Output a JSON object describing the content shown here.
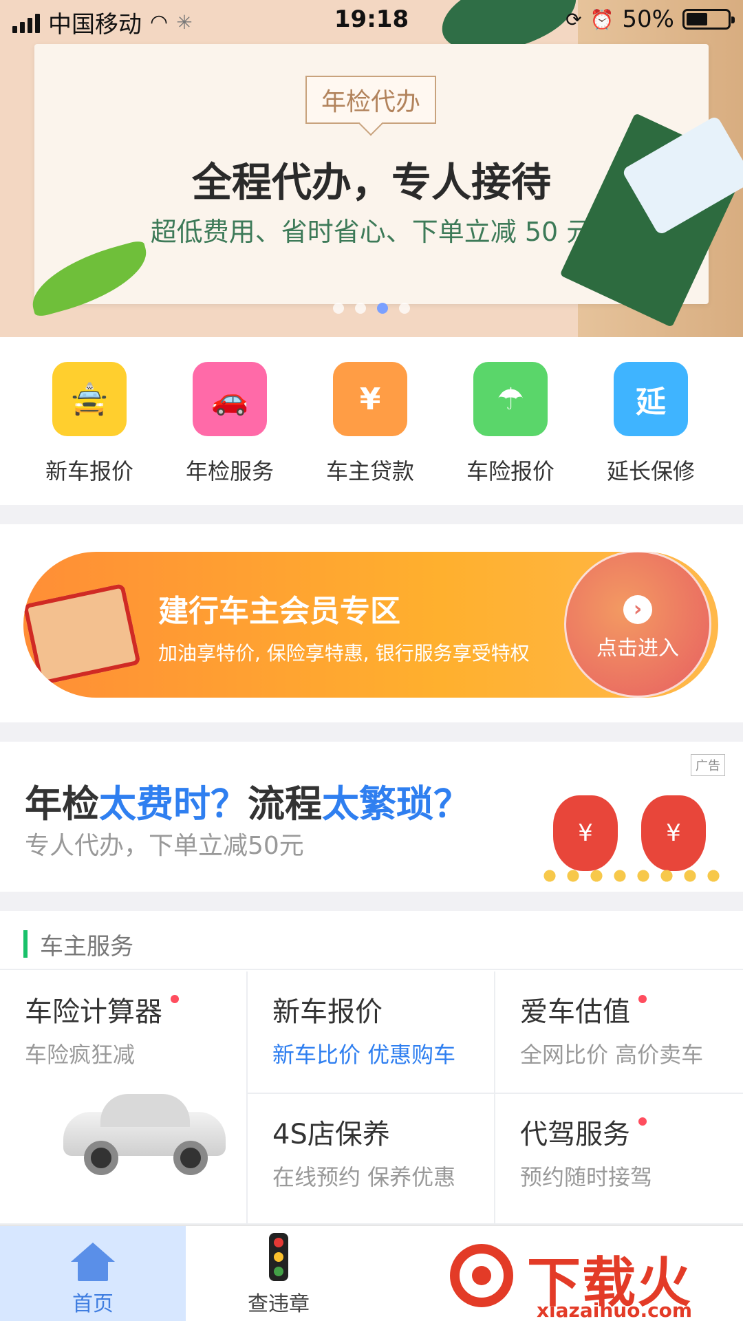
{
  "status_bar": {
    "carrier": "中国移动",
    "time": "19:18",
    "battery": "50%"
  },
  "banner": {
    "tag": "年检代办",
    "headline": "全程代办，专人接待",
    "subline": "超低费用、省时省心、下单立减 50 元",
    "page_count": 4,
    "active_page": 3
  },
  "quick_actions": [
    {
      "label": "新车报价",
      "icon": "taxi-icon",
      "color": "#ffcf2e"
    },
    {
      "label": "年检服务",
      "icon": "car-inspection-icon",
      "color": "#ff6aa8"
    },
    {
      "label": "车主贷款",
      "icon": "money-bag-icon",
      "color": "#ff9d45"
    },
    {
      "label": "车险报价",
      "icon": "umbrella-icon",
      "color": "#5ad66a"
    },
    {
      "label": "延长保修",
      "icon": "extend-icon",
      "color": "#3fb4ff"
    }
  ],
  "promo": {
    "title": "建行车主会员专区",
    "subtitle": "加油享特价, 保险享特惠, 银行服务享受特权",
    "enter_label": "点击进入"
  },
  "ad": {
    "badge": "广告",
    "q_part1": "年检",
    "q_part2": "太费时？",
    "q_part3": "流程",
    "q_part4": "太繁琐？",
    "subline": "专人代办，下单立减50元"
  },
  "services": {
    "section_title": "车主服务",
    "items": [
      {
        "name": "车险计算器",
        "desc": "车险疯狂减",
        "badge": true
      },
      {
        "name": "新车报价",
        "desc": "新车比价 优惠购车",
        "badge": false
      },
      {
        "name": "爱车估值",
        "desc": "全网比价 高价卖车",
        "badge": true
      },
      {
        "name": "4S店保养",
        "desc": "在线预约 保养优惠",
        "badge": false
      },
      {
        "name": "代驾服务",
        "desc": "预约随时接驾",
        "badge": true
      }
    ]
  },
  "tabbar": {
    "home": "首页",
    "violations": "查违章"
  },
  "watermark": {
    "cn": "下载火",
    "en": "xiazaihuo.com"
  },
  "colors": {
    "accent_blue": "#2f7ff0",
    "green_bar": "#19c16a",
    "red_dot": "#ff4d5e"
  }
}
